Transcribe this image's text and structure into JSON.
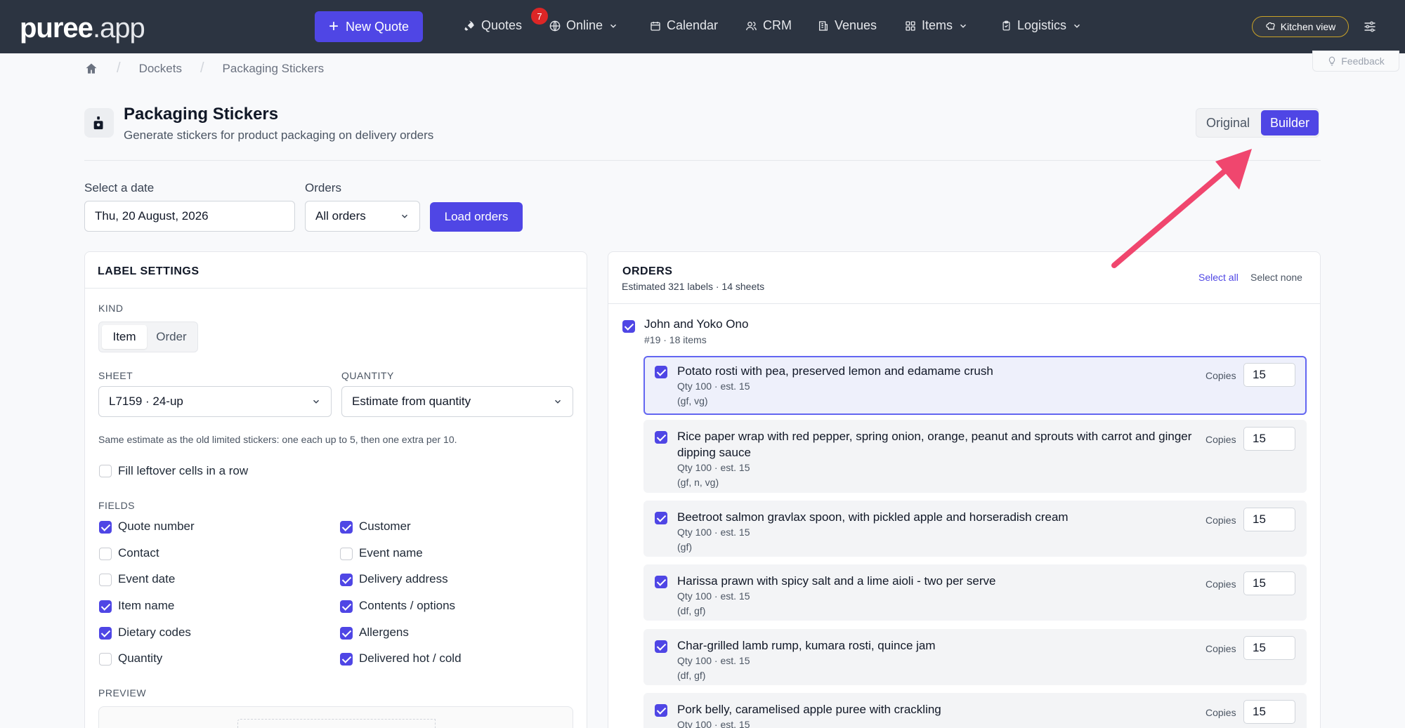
{
  "app": {
    "logo_main": "puree",
    "logo_suffix": ".app"
  },
  "nav": {
    "new_quote": "New Quote",
    "quotes": "Quotes",
    "quotes_badge": "7",
    "online": "Online",
    "calendar": "Calendar",
    "crm": "CRM",
    "venues": "Venues",
    "items": "Items",
    "logistics": "Logistics",
    "kitchen_view": "Kitchen view"
  },
  "breadcrumb": {
    "dockets": "Dockets",
    "current": "Packaging Stickers"
  },
  "feedback": "Feedback",
  "header": {
    "title": "Packaging Stickers",
    "subtitle": "Generate stickers for product packaging on delivery orders",
    "view_original": "Original",
    "view_builder": "Builder"
  },
  "controls": {
    "date_label": "Select a date",
    "date_value": "Thu, 20 August, 2026",
    "orders_label": "Orders",
    "orders_value": "All orders",
    "load_button": "Load orders"
  },
  "label_settings": {
    "title": "LABEL SETTINGS",
    "kind_label": "KIND",
    "kind_item": "Item",
    "kind_order": "Order",
    "sheet_label": "SHEET",
    "sheet_value": "L7159 · 24-up",
    "quantity_label": "QUANTITY",
    "quantity_value": "Estimate from quantity",
    "hint": "Same estimate as the old limited stickers: one each up to 5, then one extra per 10.",
    "fill_leftover": "Fill leftover cells in a row",
    "fields_label": "FIELDS",
    "fields": [
      {
        "label": "Quote number",
        "checked": true
      },
      {
        "label": "Customer",
        "checked": true
      },
      {
        "label": "Contact",
        "checked": false
      },
      {
        "label": "Event name",
        "checked": false
      },
      {
        "label": "Event date",
        "checked": false
      },
      {
        "label": "Delivery address",
        "checked": true
      },
      {
        "label": "Item name",
        "checked": true
      },
      {
        "label": "Contents / options",
        "checked": true
      },
      {
        "label": "Dietary codes",
        "checked": true
      },
      {
        "label": "Allergens",
        "checked": true
      },
      {
        "label": "Quantity",
        "checked": false
      },
      {
        "label": "Delivered hot / cold",
        "checked": true
      }
    ],
    "preview_label": "PREVIEW"
  },
  "orders": {
    "title": "ORDERS",
    "subtitle": "Estimated 321 labels · 14 sheets",
    "select_all": "Select all",
    "select_none": "Select none",
    "customer": "John and Yoko Ono",
    "customer_meta": "#19  · 18 items",
    "copies_label": "Copies",
    "items": [
      {
        "name": "Potato rosti with pea, preserved lemon and edamame crush",
        "qty": "Qty 100 · est. 15",
        "diet": "(gf, vg)",
        "copies": "15"
      },
      {
        "name": "Rice paper wrap with red pepper, spring onion, orange, peanut and sprouts with carrot and ginger dipping sauce",
        "qty": "Qty 100 · est. 15",
        "diet": "(gf, n, vg)",
        "copies": "15"
      },
      {
        "name": "Beetroot salmon gravlax spoon, with pickled apple and horseradish cream",
        "qty": "Qty 100 · est. 15",
        "diet": "(gf)",
        "copies": "15"
      },
      {
        "name": "Harissa prawn with spicy salt and a lime aioli - two per serve",
        "qty": "Qty 100 · est. 15",
        "diet": "(df, gf)",
        "copies": "15"
      },
      {
        "name": "Char-grilled lamb rump, kumara rosti, quince jam",
        "qty": "Qty 100 · est. 15",
        "diet": "(df, gf)",
        "copies": "15"
      },
      {
        "name": "Pork belly, caramelised apple puree with crackling",
        "qty": "Qty 100 · est. 15",
        "diet": "",
        "copies": "15"
      }
    ]
  },
  "colors": {
    "accent": "#4f46e5",
    "nav_bg": "#2c3441",
    "annotation_arrow": "#f0466e"
  }
}
